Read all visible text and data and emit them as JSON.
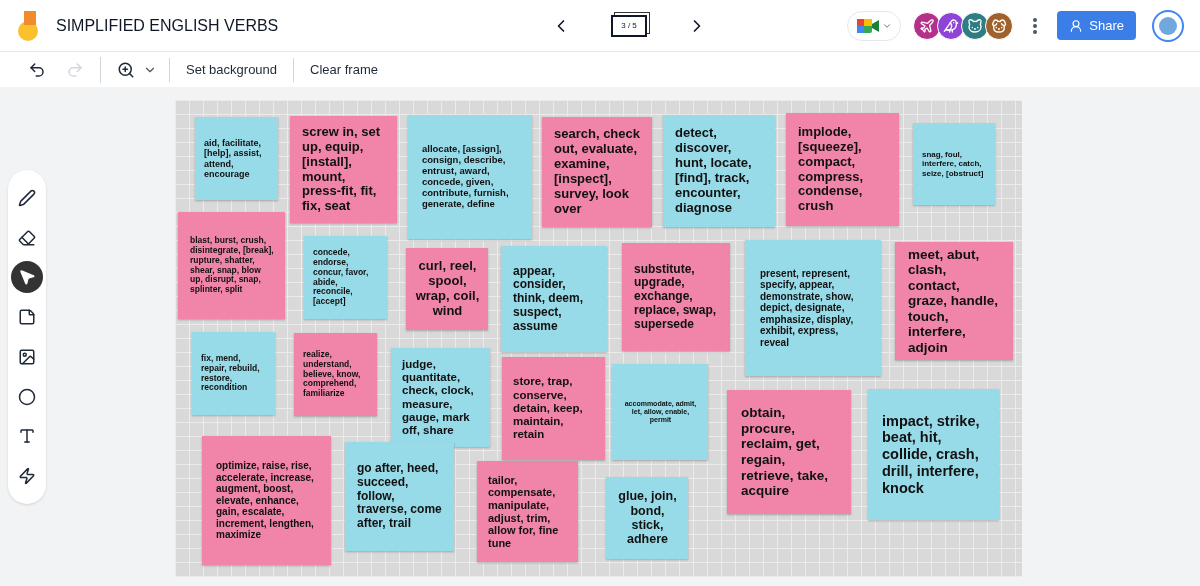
{
  "app": {
    "title": "SIMPLIFIED ENGLISH VERBS",
    "frame_counter": "3 / 5",
    "share_label": "Share"
  },
  "collaborators": [
    {
      "kind": "plane",
      "color": "#b5308a"
    },
    {
      "kind": "bird",
      "color": "#8e44d6"
    },
    {
      "kind": "cat",
      "color": "#2e7d82"
    },
    {
      "kind": "dog",
      "color": "#a0622d"
    }
  ],
  "toolbar": [
    {
      "kind": "undo",
      "disabled": false
    },
    {
      "kind": "redo",
      "disabled": true
    },
    {
      "kind": "zoom",
      "disabled": false
    },
    {
      "kind": "text",
      "label": "Set background",
      "disabled": false
    },
    {
      "kind": "text",
      "label": "Clear frame",
      "disabled": false
    }
  ],
  "tools": [
    {
      "kind": "pen",
      "selected": false
    },
    {
      "kind": "eraser",
      "selected": false
    },
    {
      "kind": "select",
      "selected": true
    },
    {
      "kind": "sticky-note",
      "selected": false
    },
    {
      "kind": "image",
      "selected": false
    },
    {
      "kind": "circle",
      "selected": false
    },
    {
      "kind": "text-box",
      "selected": false
    },
    {
      "kind": "laser",
      "selected": false
    }
  ],
  "notes": [
    {
      "color": "#98dbe8",
      "text": "aid, facilitate, [help], assist, attend, encourage"
    },
    {
      "color": "#f185a9",
      "text": "screw in, set up, equip, [install], mount, press-fit, fit, fix, seat"
    },
    {
      "color": "#98dbe8",
      "text": "allocate, [assign], consign, describe, entrust, award, concede, given, contribute, furnish, generate, define"
    },
    {
      "color": "#f185a9",
      "text": "search, check out, evaluate, examine, [inspect], survey, look over"
    },
    {
      "color": "#98dbe8",
      "text": "detect, discover, hunt, locate, [find], track, encounter, diagnose"
    },
    {
      "color": "#f185a9",
      "text": "implode, [squeeze], compact, compress, condense, crush"
    },
    {
      "color": "#98dbe8",
      "text": "snag, foul, interfere, catch, seize, [obstruct]"
    },
    {
      "color": "#f185a9",
      "text": "blast, burst, crush, disintegrate, [break], rupture, shatter, shear, snap, blow up, disrupt, snap, splinter, split"
    },
    {
      "color": "#98dbe8",
      "text": "concede, endorse, concur, favor, abide, reconcile, [accept]"
    },
    {
      "color": "#f185a9",
      "text": "curl, reel, spool, wrap, coil, wind"
    },
    {
      "color": "#98dbe8",
      "text": "appear, consider, think, deem, suspect, assume"
    },
    {
      "color": "#f185a9",
      "text": "substitute, upgrade, exchange, replace, swap, supersede"
    },
    {
      "color": "#98dbe8",
      "text": "present, represent, specify, appear, demonstrate, show, depict, designate, emphasize, display, exhibit, express, reveal"
    },
    {
      "color": "#f185a9",
      "text": "meet, abut, clash, contact, graze, handle, touch, interfere, adjoin"
    },
    {
      "color": "#98dbe8",
      "text": "fix, mend, repair, rebuild, restore, recondition"
    },
    {
      "color": "#f185a9",
      "text": "realize, understand, believe, know, comprehend, familiarize"
    },
    {
      "color": "#98dbe8",
      "text": "judge, quantitate, check, clock, measure, gauge, mark off, share"
    },
    {
      "color": "#f185a9",
      "text": "store, trap, conserve, detain, keep, maintain, retain"
    },
    {
      "color": "#98dbe8",
      "text": "accommodate, admit, let, allow, enable, permit"
    },
    {
      "color": "#f185a9",
      "text": "obtain, procure, reclaim, get, regain, retrieve, take, acquire"
    },
    {
      "color": "#98dbe8",
      "text": "impact, strike, beat, hit, collide, crash, drill, interfere, knock"
    },
    {
      "color": "#f185a9",
      "text": "optimize, raise, rise, accelerate, increase, augment, boost, elevate, enhance, gain, escalate, increment, lengthen, maximize"
    },
    {
      "color": "#98dbe8",
      "text": "go after, heed, succeed, follow, traverse, come after, trail"
    },
    {
      "color": "#f185a9",
      "text": "tailor, compensate, manipulate, adjust, trim, allow for, fine tune"
    },
    {
      "color": "#98dbe8",
      "text": "glue, join, bond, stick, adhere"
    }
  ]
}
